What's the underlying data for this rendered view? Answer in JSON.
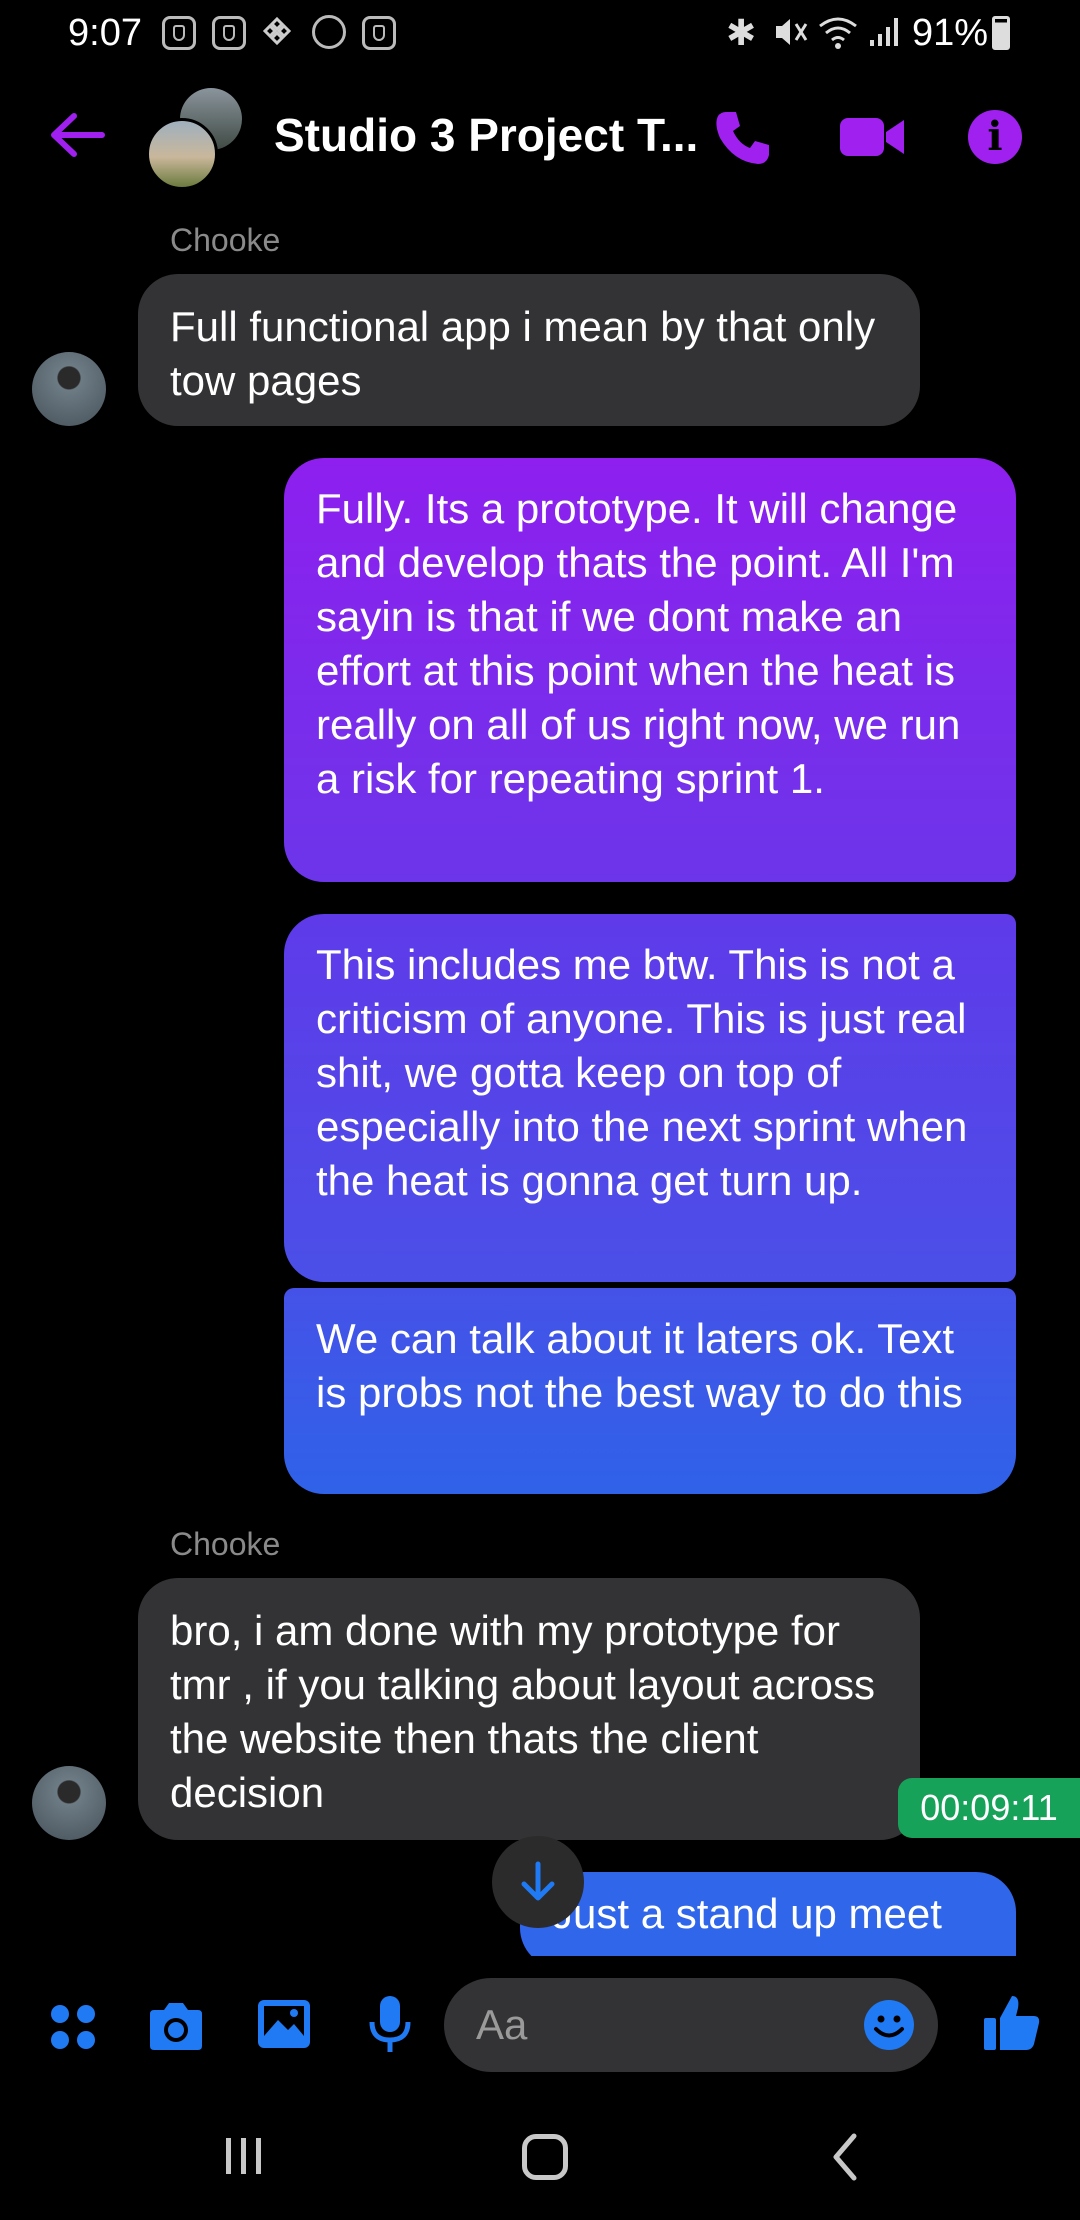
{
  "status_bar": {
    "time": "9:07",
    "battery": "91%",
    "icons": [
      "app-icon",
      "app-icon",
      "binance-icon",
      "messenger-icon",
      "app-icon",
      "bluetooth-icon",
      "mute-icon",
      "wifi-icon",
      "signal-icon",
      "battery-icon"
    ]
  },
  "header": {
    "title": "Studio 3 Project T...",
    "accent_color": "#a020f0"
  },
  "messages": [
    {
      "sender": "Chooke",
      "direction": "incoming",
      "text": "Full functional app i mean by that only tow pages"
    },
    {
      "direction": "outgoing",
      "text": "Fully. Its a prototype. It will change and develop thats the point. All I'm sayin is that if we dont make an effort at this point when the heat is really on all of us right now, we run a risk for repeating sprint 1."
    },
    {
      "direction": "outgoing",
      "text": "This includes me btw. This is not a criticism of anyone. This is just real shit, we gotta keep on top of especially into the next sprint when the heat is gonna get turn up."
    },
    {
      "direction": "outgoing",
      "text": "We can talk about it laters ok. Text is probs not the best way to do this"
    },
    {
      "sender": "Chooke",
      "direction": "incoming",
      "text": "bro, i am  done with my prototype for tmr , if you talking about layout across the website then thats the client decision"
    },
    {
      "direction": "outgoing",
      "text": "Just a stand up meet"
    }
  ],
  "timestamp_chip": "00:09:11",
  "composer": {
    "placeholder": "Aa",
    "accent_color": "#1f7af3"
  },
  "colors": {
    "background": "#000000",
    "incoming_bubble": "#333335",
    "outgoing_gradient_top": "#8e1fee",
    "outgoing_gradient_bottom": "#2f62e8",
    "timestamp_chip": "#17a25a"
  }
}
